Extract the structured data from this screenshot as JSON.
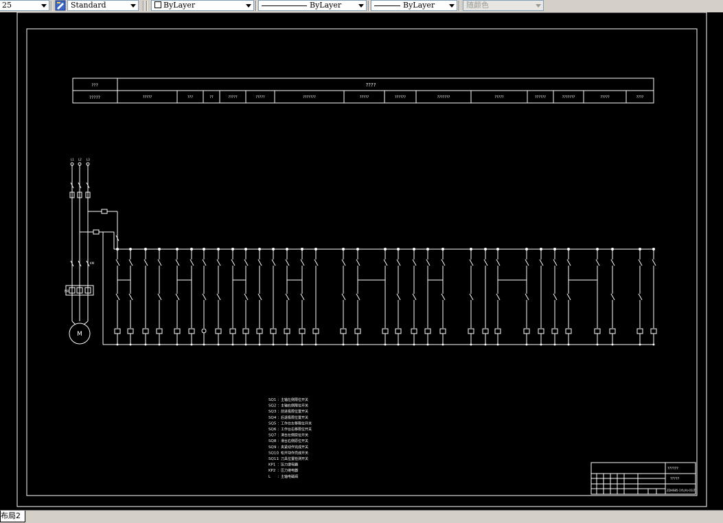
{
  "toolbar": {
    "lineweight_scale": "25",
    "text_style": "Standard",
    "layer": "ByLayer",
    "linetype": "ByLayer",
    "lineweight": "ByLayer",
    "plot_color": "随颜色"
  },
  "layout_tab": "布局2",
  "drawing": {
    "header_top": "????",
    "header_left_top": "???",
    "header_left_bottom": "?????",
    "header_cells": [
      "?????",
      "???",
      "??",
      "?????",
      "?????",
      "???????",
      "?????",
      "??????",
      "???????",
      "?????",
      "??????",
      "???????",
      "?????",
      "????"
    ],
    "supply_labels": [
      "L1",
      "L2",
      "L3"
    ],
    "motor_label": "M",
    "fr_label": "FR",
    "km_label": "KM",
    "legend": [
      {
        "code": "SQ1",
        "text": "：主轴左侧限位开关"
      },
      {
        "code": "SQ2",
        "text": "：主轴右侧限位开关"
      },
      {
        "code": "SQ3",
        "text": "：前进极限位置开关"
      },
      {
        "code": "SQ4",
        "text": "：后退极限位置开关"
      },
      {
        "code": "SQ5",
        "text": "：工作台左移限位开关"
      },
      {
        "code": "SQ6",
        "text": "：工作台右移限位开关"
      },
      {
        "code": "SQ7",
        "text": "：滑台左侧原位开关"
      },
      {
        "code": "SQ8",
        "text": "：滑台右侧原位开关"
      },
      {
        "code": "SQ9",
        "text": "：夹紧动作完成开关"
      },
      {
        "code": "SQ10",
        "text": "：松开动作完成开关"
      },
      {
        "code": "SQ11",
        "text": "：刀具位置检测开关"
      },
      {
        "code": "KP1",
        "text": "：压力继电器"
      },
      {
        "code": "KP2",
        "text": "：压力继电器"
      },
      {
        "code": "L",
        "text": "：主轴电磁阀"
      }
    ],
    "title_block": {
      "name": "??????",
      "sub": "?????",
      "drawing_no": "ZDHS85-1YL(A)-01LT"
    }
  }
}
